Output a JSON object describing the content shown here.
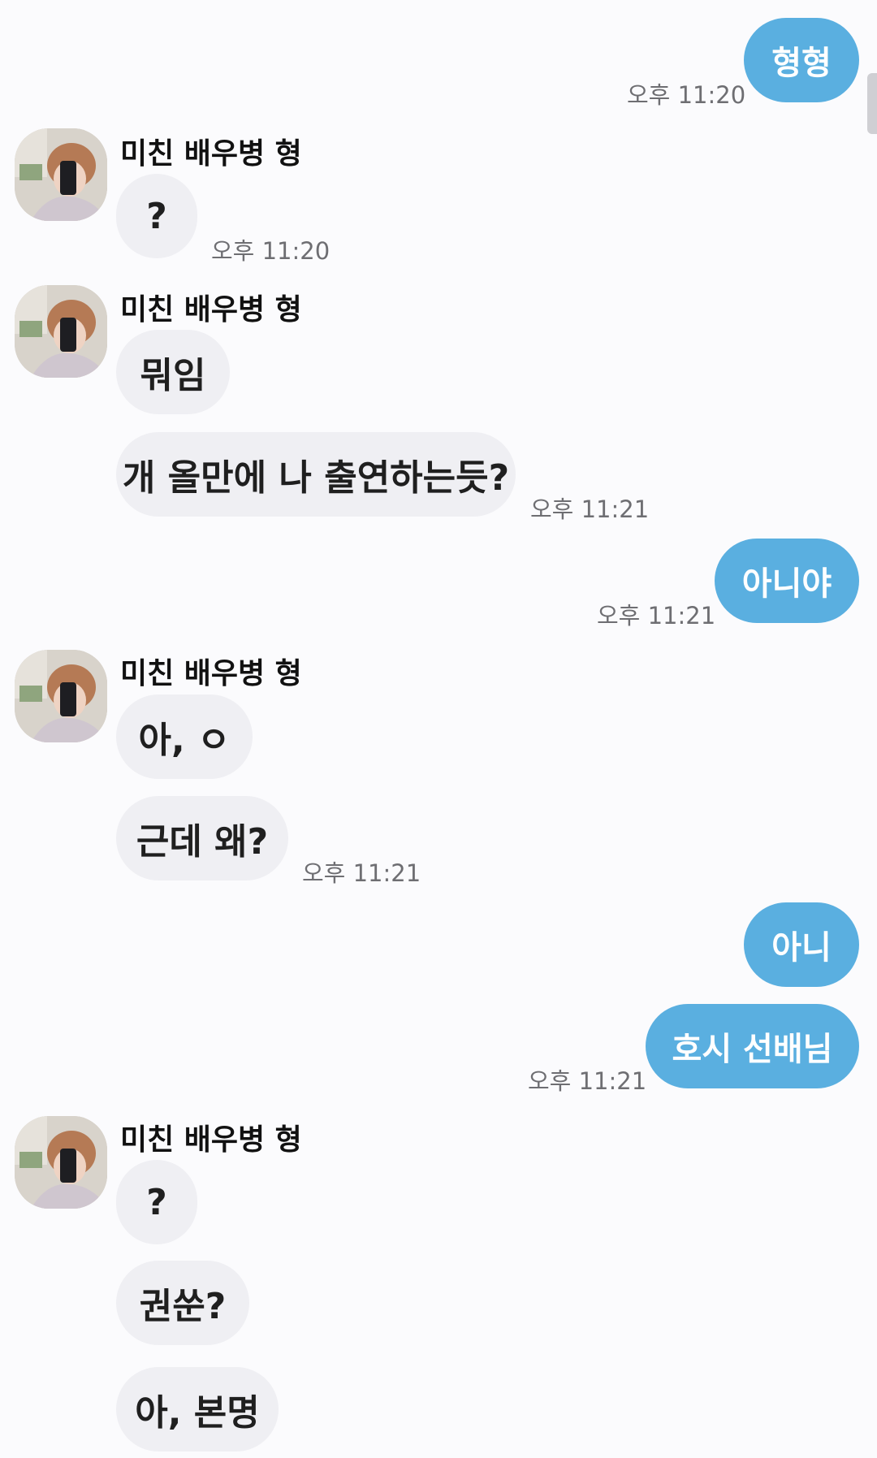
{
  "contact": {
    "name": "미친 배우병 형"
  },
  "messages": {
    "m1": {
      "text": "형형",
      "time": "오후 11:20"
    },
    "m2": {
      "text": "?",
      "time": "오후 11:20"
    },
    "m3": {
      "text": "뭐임"
    },
    "m4": {
      "text": "개 올만에 나 출연하는듯?",
      "time": "오후 11:21"
    },
    "m5": {
      "text": "아니야",
      "time": "오후 11:21"
    },
    "m6": {
      "text": "아, ㅇ"
    },
    "m7": {
      "text": "근데 왜?",
      "time": "오후 11:21"
    },
    "m8": {
      "text": "아니"
    },
    "m9": {
      "text": "호시 선배님",
      "time": "오후 11:21"
    },
    "m10": {
      "text": "?"
    },
    "m11": {
      "text": "권쑨?"
    },
    "m12": {
      "text": "아, 본명"
    }
  },
  "colors": {
    "background": "#fbfbfd",
    "incoming_bubble": "#efeff3",
    "outgoing_bubble": "#5aafe0",
    "timestamp": "#6e6e72"
  },
  "icons": {
    "avatar": "profile-photo-avatar"
  }
}
